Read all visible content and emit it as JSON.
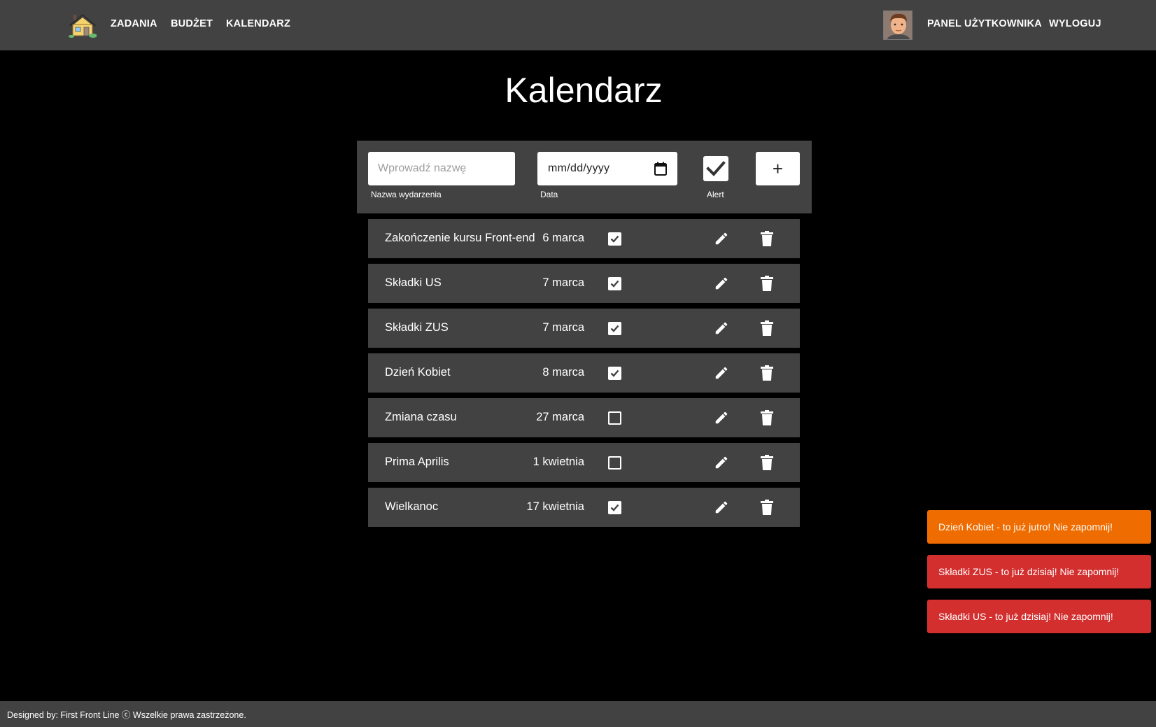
{
  "nav": {
    "links": [
      "ZADANIA",
      "BUDŻET",
      "KALENDARZ"
    ],
    "user_panel": "PANEL UŻYTKOWNIKA",
    "logout": "WYLOGUJ"
  },
  "page_title": "Kalendarz",
  "form": {
    "name_placeholder": "Wprowadź nazwę",
    "name_label": "Nazwa wydarzenia",
    "date_placeholder": "mm/dd/yyyy",
    "date_label": "Data",
    "alert_label": "Alert",
    "alert_checked": true,
    "add_label": "+"
  },
  "events": [
    {
      "name": "Zakończenie kursu Front-end",
      "date": "6 marca",
      "alert": true
    },
    {
      "name": "Składki US",
      "date": "7 marca",
      "alert": true
    },
    {
      "name": "Składki ZUS",
      "date": "7 marca",
      "alert": true
    },
    {
      "name": "Dzień Kobiet",
      "date": "8 marca",
      "alert": true
    },
    {
      "name": "Zmiana czasu",
      "date": "27 marca",
      "alert": false
    },
    {
      "name": "Prima Aprilis",
      "date": "1 kwietnia",
      "alert": false
    },
    {
      "name": "Wielkanoc",
      "date": "17 kwietnia",
      "alert": true
    }
  ],
  "toasts": [
    {
      "text": "Dzień Kobiet - to już jutro! Nie zapomnij!",
      "color": "#ef6c00"
    },
    {
      "text": "Składki ZUS - to już dzisiaj! Nie zapomnij!",
      "color": "#d32f2f"
    },
    {
      "text": "Składki US - to już dzisiaj! Nie zapomnij!",
      "color": "#d32f2f"
    }
  ],
  "footer": "Designed by: First Front Line ⓒ Wszelkie prawa zastrzeżone."
}
